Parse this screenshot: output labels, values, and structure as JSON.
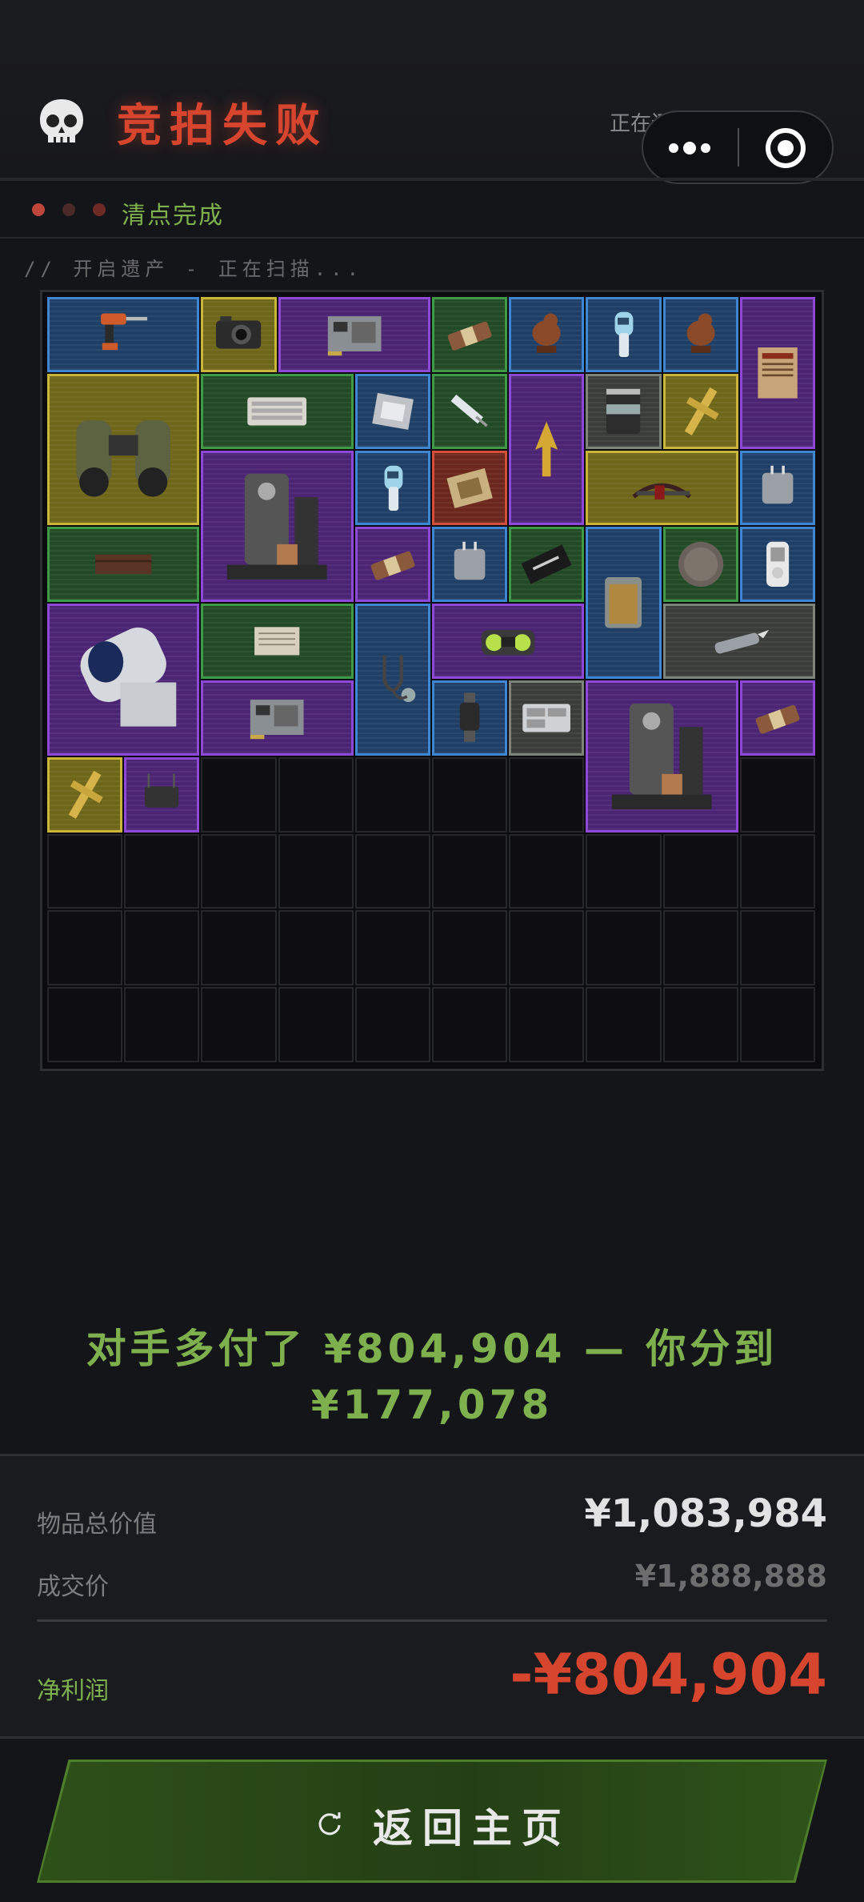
{
  "header": {
    "title": "竞拍失败",
    "restoring_text": "正在还原遗产情报...",
    "skull_icon": "skull-icon",
    "capsule": {
      "more_icon": "more-dots-icon",
      "target_icon": "target-icon"
    }
  },
  "progress": {
    "label": "清点完成",
    "dots": [
      {
        "color": "#c0453a"
      },
      {
        "color": "#4a2a28"
      },
      {
        "color": "#6e2b26"
      }
    ]
  },
  "scan": {
    "text": "// 开启遗产 - 正在扫描..."
  },
  "inventory": {
    "columns": 10,
    "rows": 10,
    "items": [
      {
        "name": "power-drill",
        "rarity": "blue",
        "col": 0,
        "row": 0,
        "w": 2,
        "h": 1
      },
      {
        "name": "camera",
        "rarity": "gold",
        "col": 2,
        "row": 0,
        "w": 1,
        "h": 1
      },
      {
        "name": "circuit-board",
        "rarity": "purple",
        "col": 3,
        "row": 0,
        "w": 2,
        "h": 1
      },
      {
        "name": "snack-bar",
        "rarity": "green",
        "col": 5,
        "row": 0,
        "w": 1,
        "h": 1
      },
      {
        "name": "bird-figurine",
        "rarity": "blue",
        "col": 6,
        "row": 0,
        "w": 1,
        "h": 1
      },
      {
        "name": "thermometer",
        "rarity": "blue",
        "col": 7,
        "row": 0,
        "w": 1,
        "h": 1
      },
      {
        "name": "bird-figurine",
        "rarity": "blue",
        "col": 8,
        "row": 0,
        "w": 1,
        "h": 1
      },
      {
        "name": "book-black-tide",
        "rarity": "purple",
        "col": 9,
        "row": 0,
        "w": 1,
        "h": 2
      },
      {
        "name": "binoculars",
        "rarity": "gold",
        "col": 0,
        "row": 1,
        "w": 2,
        "h": 2
      },
      {
        "name": "keyboard",
        "rarity": "green",
        "col": 2,
        "row": 1,
        "w": 2,
        "h": 1
      },
      {
        "name": "cpu-chip",
        "rarity": "blue",
        "col": 4,
        "row": 1,
        "w": 1,
        "h": 1
      },
      {
        "name": "syringe",
        "rarity": "green",
        "col": 5,
        "row": 1,
        "w": 1,
        "h": 1
      },
      {
        "name": "golden-arrowhead",
        "rarity": "purple",
        "col": 6,
        "row": 1,
        "w": 1,
        "h": 2
      },
      {
        "name": "protein-can",
        "rarity": "grey",
        "col": 7,
        "row": 1,
        "w": 1,
        "h": 1
      },
      {
        "name": "golden-cross",
        "rarity": "gold",
        "col": 8,
        "row": 1,
        "w": 1,
        "h": 1
      },
      {
        "name": "coffee-machine",
        "rarity": "purple",
        "col": 2,
        "row": 2,
        "w": 2,
        "h": 2
      },
      {
        "name": "thermometer",
        "rarity": "blue",
        "col": 4,
        "row": 2,
        "w": 1,
        "h": 1
      },
      {
        "name": "signal-splitter",
        "rarity": "red",
        "col": 5,
        "row": 2,
        "w": 1,
        "h": 1
      },
      {
        "name": "crossbow",
        "rarity": "gold",
        "col": 7,
        "row": 2,
        "w": 2,
        "h": 1
      },
      {
        "name": "plug-adapter",
        "rarity": "blue",
        "col": 9,
        "row": 2,
        "w": 1,
        "h": 1
      },
      {
        "name": "wood-plank",
        "rarity": "green",
        "col": 0,
        "row": 3,
        "w": 2,
        "h": 1
      },
      {
        "name": "snack-bar",
        "rarity": "purple",
        "col": 4,
        "row": 3,
        "w": 1,
        "h": 1
      },
      {
        "name": "plug-adapter",
        "rarity": "blue",
        "col": 5,
        "row": 3,
        "w": 1,
        "h": 1
      },
      {
        "name": "card",
        "rarity": "green",
        "col": 6,
        "row": 3,
        "w": 1,
        "h": 1
      },
      {
        "name": "ammo-jar",
        "rarity": "blue",
        "col": 7,
        "row": 3,
        "w": 1,
        "h": 2
      },
      {
        "name": "old-coin",
        "rarity": "green",
        "col": 8,
        "row": 3,
        "w": 1,
        "h": 1
      },
      {
        "name": "mp3-player",
        "rarity": "blue",
        "col": 9,
        "row": 3,
        "w": 1,
        "h": 1
      },
      {
        "name": "scanner-device",
        "rarity": "purple",
        "col": 0,
        "row": 4,
        "w": 2,
        "h": 2
      },
      {
        "name": "old-paper",
        "rarity": "green",
        "col": 2,
        "row": 4,
        "w": 2,
        "h": 1
      },
      {
        "name": "stethoscope",
        "rarity": "blue",
        "col": 4,
        "row": 4,
        "w": 1,
        "h": 2
      },
      {
        "name": "boombox",
        "rarity": "purple",
        "col": 5,
        "row": 4,
        "w": 2,
        "h": 1
      },
      {
        "name": "utility-knife",
        "rarity": "grey",
        "col": 8,
        "row": 4,
        "w": 2,
        "h": 1
      },
      {
        "name": "circuit-board",
        "rarity": "purple",
        "col": 2,
        "row": 5,
        "w": 2,
        "h": 1
      },
      {
        "name": "smart-watch",
        "rarity": "blue",
        "col": 5,
        "row": 5,
        "w": 1,
        "h": 1
      },
      {
        "name": "parts-box",
        "rarity": "grey",
        "col": 6,
        "row": 5,
        "w": 1,
        "h": 1
      },
      {
        "name": "coffee-machine",
        "rarity": "purple",
        "col": 7,
        "row": 5,
        "w": 2,
        "h": 2
      },
      {
        "name": "snack-bar",
        "rarity": "purple",
        "col": 9,
        "row": 5,
        "w": 1,
        "h": 1
      },
      {
        "name": "golden-cross",
        "rarity": "gold",
        "col": 0,
        "row": 6,
        "w": 1,
        "h": 1
      },
      {
        "name": "antenna-device",
        "rarity": "purple",
        "col": 1,
        "row": 6,
        "w": 1,
        "h": 1
      }
    ]
  },
  "result": {
    "line1": "对手多付了 ¥804,904 — 你分到",
    "line2": "¥177,078"
  },
  "panel": {
    "total_label": "物品总价值",
    "total_value": "¥1,083,984",
    "deal_label": "成交价",
    "deal_value": "¥1,888,888",
    "profit_label": "净利润",
    "profit_value": "-¥804,904"
  },
  "colors": {
    "accent_red": "#d8452f",
    "accent_green": "#7fb04e"
  },
  "home_button": {
    "label": "返回主页",
    "icon": "refresh-icon"
  }
}
